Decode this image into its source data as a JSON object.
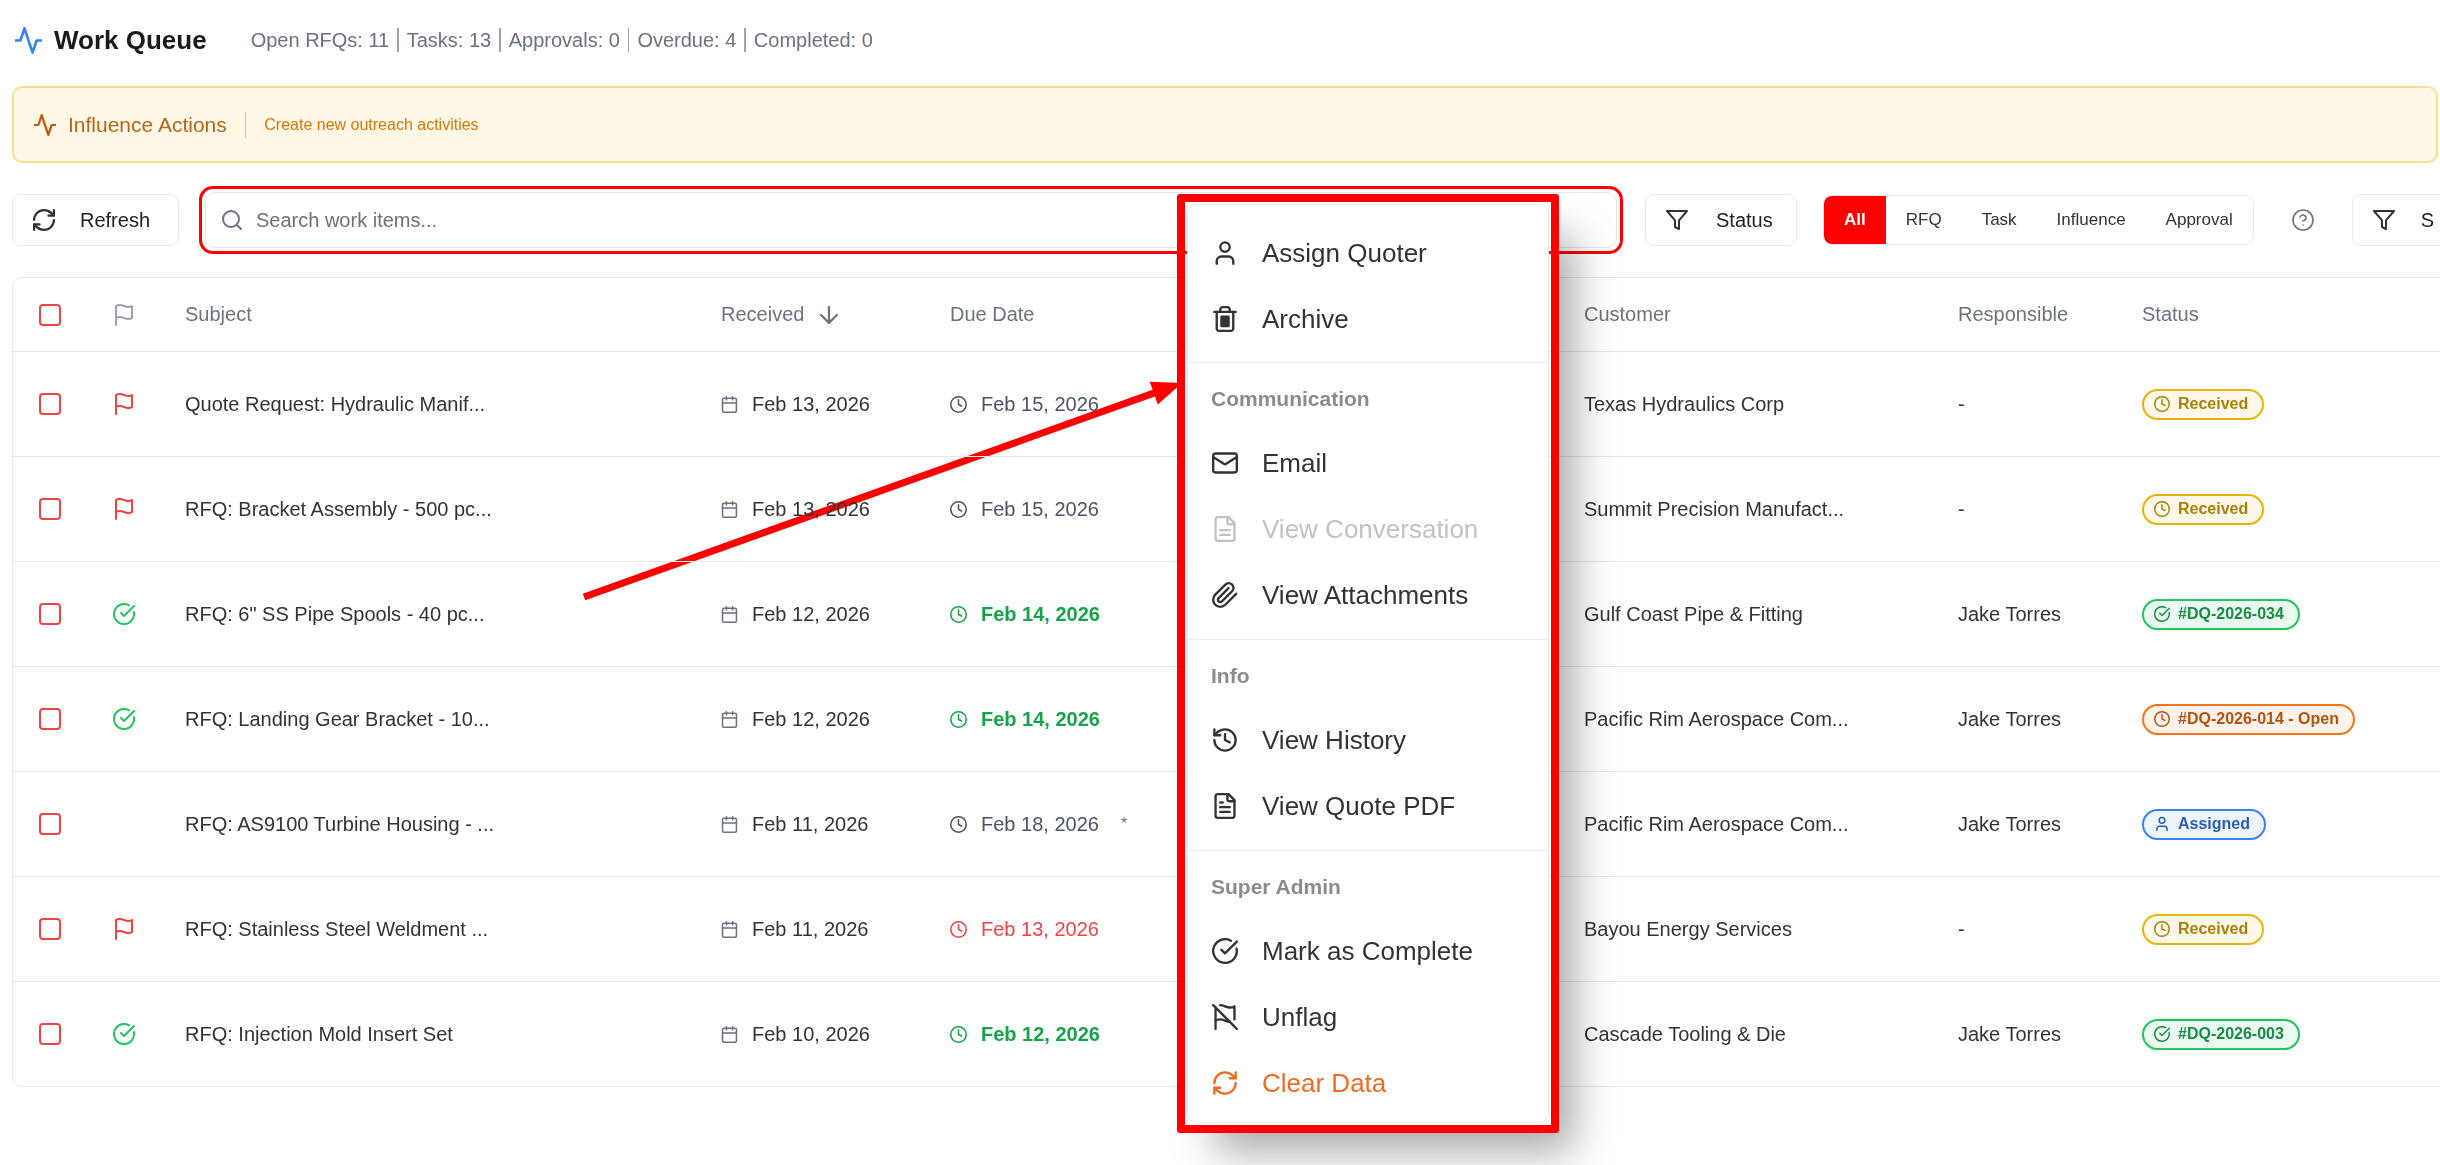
{
  "header": {
    "title": "Work Queue",
    "stats": [
      "Open RFQs: 11",
      "Tasks: 13",
      "Approvals: 0",
      "Overdue: 4",
      "Completed: 0"
    ]
  },
  "banner": {
    "title": "Influence Actions",
    "link": "Create new outreach activities"
  },
  "toolbar": {
    "refresh": "Refresh",
    "search": {
      "placeholder": "Search work items..."
    },
    "status_button": "Status",
    "type_tabs": [
      {
        "label": "All",
        "selected": true
      },
      {
        "label": "RFQ",
        "selected": false
      },
      {
        "label": "Task",
        "selected": false
      },
      {
        "label": "Influence",
        "selected": false
      },
      {
        "label": "Approval",
        "selected": false
      }
    ],
    "trailing_button": "S"
  },
  "table": {
    "select_all": {
      "checked": false
    },
    "columns": [
      {
        "label": "Subject",
        "sorted": false
      },
      {
        "label": "Received",
        "sorted": true
      },
      {
        "label": "Due Date",
        "sorted": false
      },
      {
        "label": "Customer",
        "sorted": false
      },
      {
        "label": "Responsible",
        "sorted": false
      },
      {
        "label": "Status",
        "sorted": false
      }
    ],
    "rows": [
      {
        "checked": false,
        "flagged": true,
        "done": false,
        "subject": "Quote Request: Hydraulic Manif...",
        "received": "Feb 13, 2026",
        "due": {
          "text": "Feb 15, 2026",
          "color": "#4b5563",
          "bold": false
        },
        "customer": "Texas Hydraulics Corp",
        "responsible": "-",
        "status": {
          "text": "Received",
          "kind": "pending",
          "color": "#eab308"
        }
      },
      {
        "checked": false,
        "flagged": true,
        "done": false,
        "subject": "RFQ: Bracket Assembly - 500 pc...",
        "received": "Feb 13, 2026",
        "due": {
          "text": "Feb 15, 2026",
          "color": "#4b5563",
          "bold": false
        },
        "customer": "Summit Precision Manufact...",
        "responsible": "-",
        "status": {
          "text": "Received",
          "kind": "pending",
          "color": "#eab308"
        }
      },
      {
        "checked": false,
        "flagged": false,
        "done": true,
        "subject": "RFQ: 6\" SS Pipe Spools - 40 pc...",
        "received": "Feb 12, 2026",
        "due": {
          "text": "Feb 14, 2026",
          "color": "#16a34a",
          "bold": true
        },
        "customer": "Gulf Coast Pipe & Fitting",
        "responsible": "Jake Torres",
        "status": {
          "text": "#DQ-2026-034",
          "kind": "done",
          "color": "#22c55e"
        }
      },
      {
        "checked": false,
        "flagged": false,
        "done": true,
        "subject": "RFQ: Landing Gear Bracket - 10...",
        "received": "Feb 12, 2026",
        "due": {
          "text": "Feb 14, 2026",
          "color": "#16a34a",
          "bold": true
        },
        "customer": "Pacific Rim Aerospace Com...",
        "responsible": "Jake Torres",
        "status": {
          "text": "#DQ-2026-014 - Open",
          "kind": "pending",
          "color": "#f97316"
        }
      },
      {
        "checked": false,
        "flagged": false,
        "done": false,
        "subject": "RFQ: AS9100 Turbine Housing - ...",
        "received": "Feb 11, 2026",
        "due": {
          "text": "Feb 18, 2026",
          "color": "#4b5563",
          "bold": false,
          "note": "*"
        },
        "customer": "Pacific Rim Aerospace Com...",
        "responsible": "Jake Torres",
        "status": {
          "text": "Assigned",
          "kind": "assigned",
          "color": "#3b82f6"
        }
      },
      {
        "checked": false,
        "flagged": true,
        "done": false,
        "subject": "RFQ: Stainless Steel Weldment ...",
        "received": "Feb 11, 2026",
        "due": {
          "text": "Feb 13, 2026",
          "color": "#ef4444",
          "bold": false
        },
        "customer": "Bayou Energy Services",
        "responsible": "-",
        "status": {
          "text": "Received",
          "kind": "pending",
          "color": "#eab308"
        }
      },
      {
        "checked": false,
        "flagged": false,
        "done": true,
        "subject": "RFQ: Injection Mold Insert Set",
        "received": "Feb 10, 2026",
        "due": {
          "text": "Feb 12, 2026",
          "color": "#16a34a",
          "bold": true
        },
        "customer": "Cascade Tooling & Die",
        "responsible": "Jake Torres",
        "status": {
          "text": "#DQ-2026-003",
          "kind": "done",
          "color": "#22c55e"
        }
      }
    ]
  },
  "context_menu": {
    "sections": [
      {
        "items": [
          {
            "kind": "assign",
            "label": "Assign Quoter",
            "disabled": false,
            "destructive": false
          },
          {
            "kind": "archive",
            "label": "Archive",
            "disabled": false,
            "destructive": false
          }
        ]
      },
      {
        "title": "Communication",
        "items": [
          {
            "kind": "email",
            "label": "Email",
            "disabled": false,
            "destructive": false
          },
          {
            "kind": "conversation",
            "label": "View Conversation",
            "disabled": true,
            "destructive": false
          },
          {
            "kind": "attachments",
            "label": "View Attachments",
            "disabled": false,
            "destructive": false
          }
        ]
      },
      {
        "title": "Info",
        "items": [
          {
            "kind": "history",
            "label": "View History",
            "disabled": false,
            "destructive": false
          },
          {
            "kind": "pdf",
            "label": "View Quote PDF",
            "disabled": false,
            "destructive": false
          }
        ]
      },
      {
        "title": "Super Admin",
        "items": [
          {
            "kind": "complete",
            "label": "Mark as Complete",
            "disabled": false,
            "destructive": false
          },
          {
            "kind": "unflag",
            "label": "Unflag",
            "disabled": false,
            "destructive": false
          },
          {
            "kind": "clear",
            "label": "Clear Data",
            "disabled": false,
            "destructive": true
          }
        ]
      }
    ]
  },
  "annotations": {
    "search_outline": true,
    "menu_outline": true,
    "arrow": true
  }
}
